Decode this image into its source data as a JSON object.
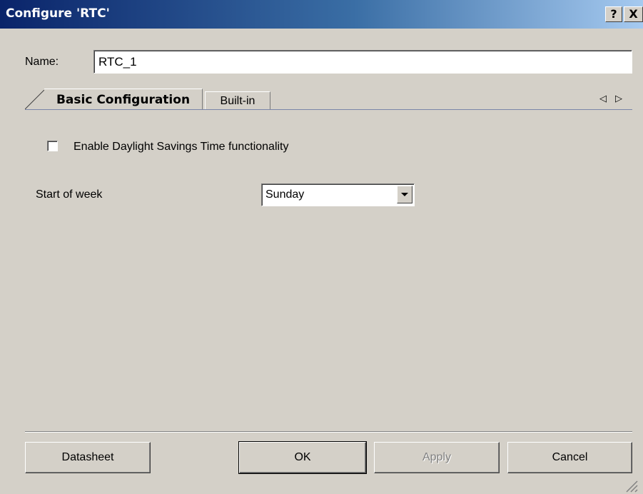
{
  "window": {
    "title": "Configure 'RTC'",
    "help_label": "?",
    "close_label": "X"
  },
  "name_field": {
    "label": "Name:",
    "value": "RTC_1"
  },
  "tabs": [
    {
      "label": "Basic Configuration",
      "active": true
    },
    {
      "label": "Built-in",
      "active": false
    }
  ],
  "tab_scroll": {
    "left": "◁",
    "right": "▷"
  },
  "options": {
    "daylight_savings": {
      "label": "Enable Daylight Savings Time functionality",
      "checked": false
    },
    "start_of_week": {
      "label": "Start of week",
      "selected": "Sunday"
    }
  },
  "buttons": {
    "datasheet": "Datasheet",
    "ok": "OK",
    "apply": "Apply",
    "cancel": "Cancel"
  },
  "colors": {
    "window_bg": "#d4d0c8",
    "titlebar_start": "#0a246a",
    "titlebar_end": "#a6caf0"
  }
}
